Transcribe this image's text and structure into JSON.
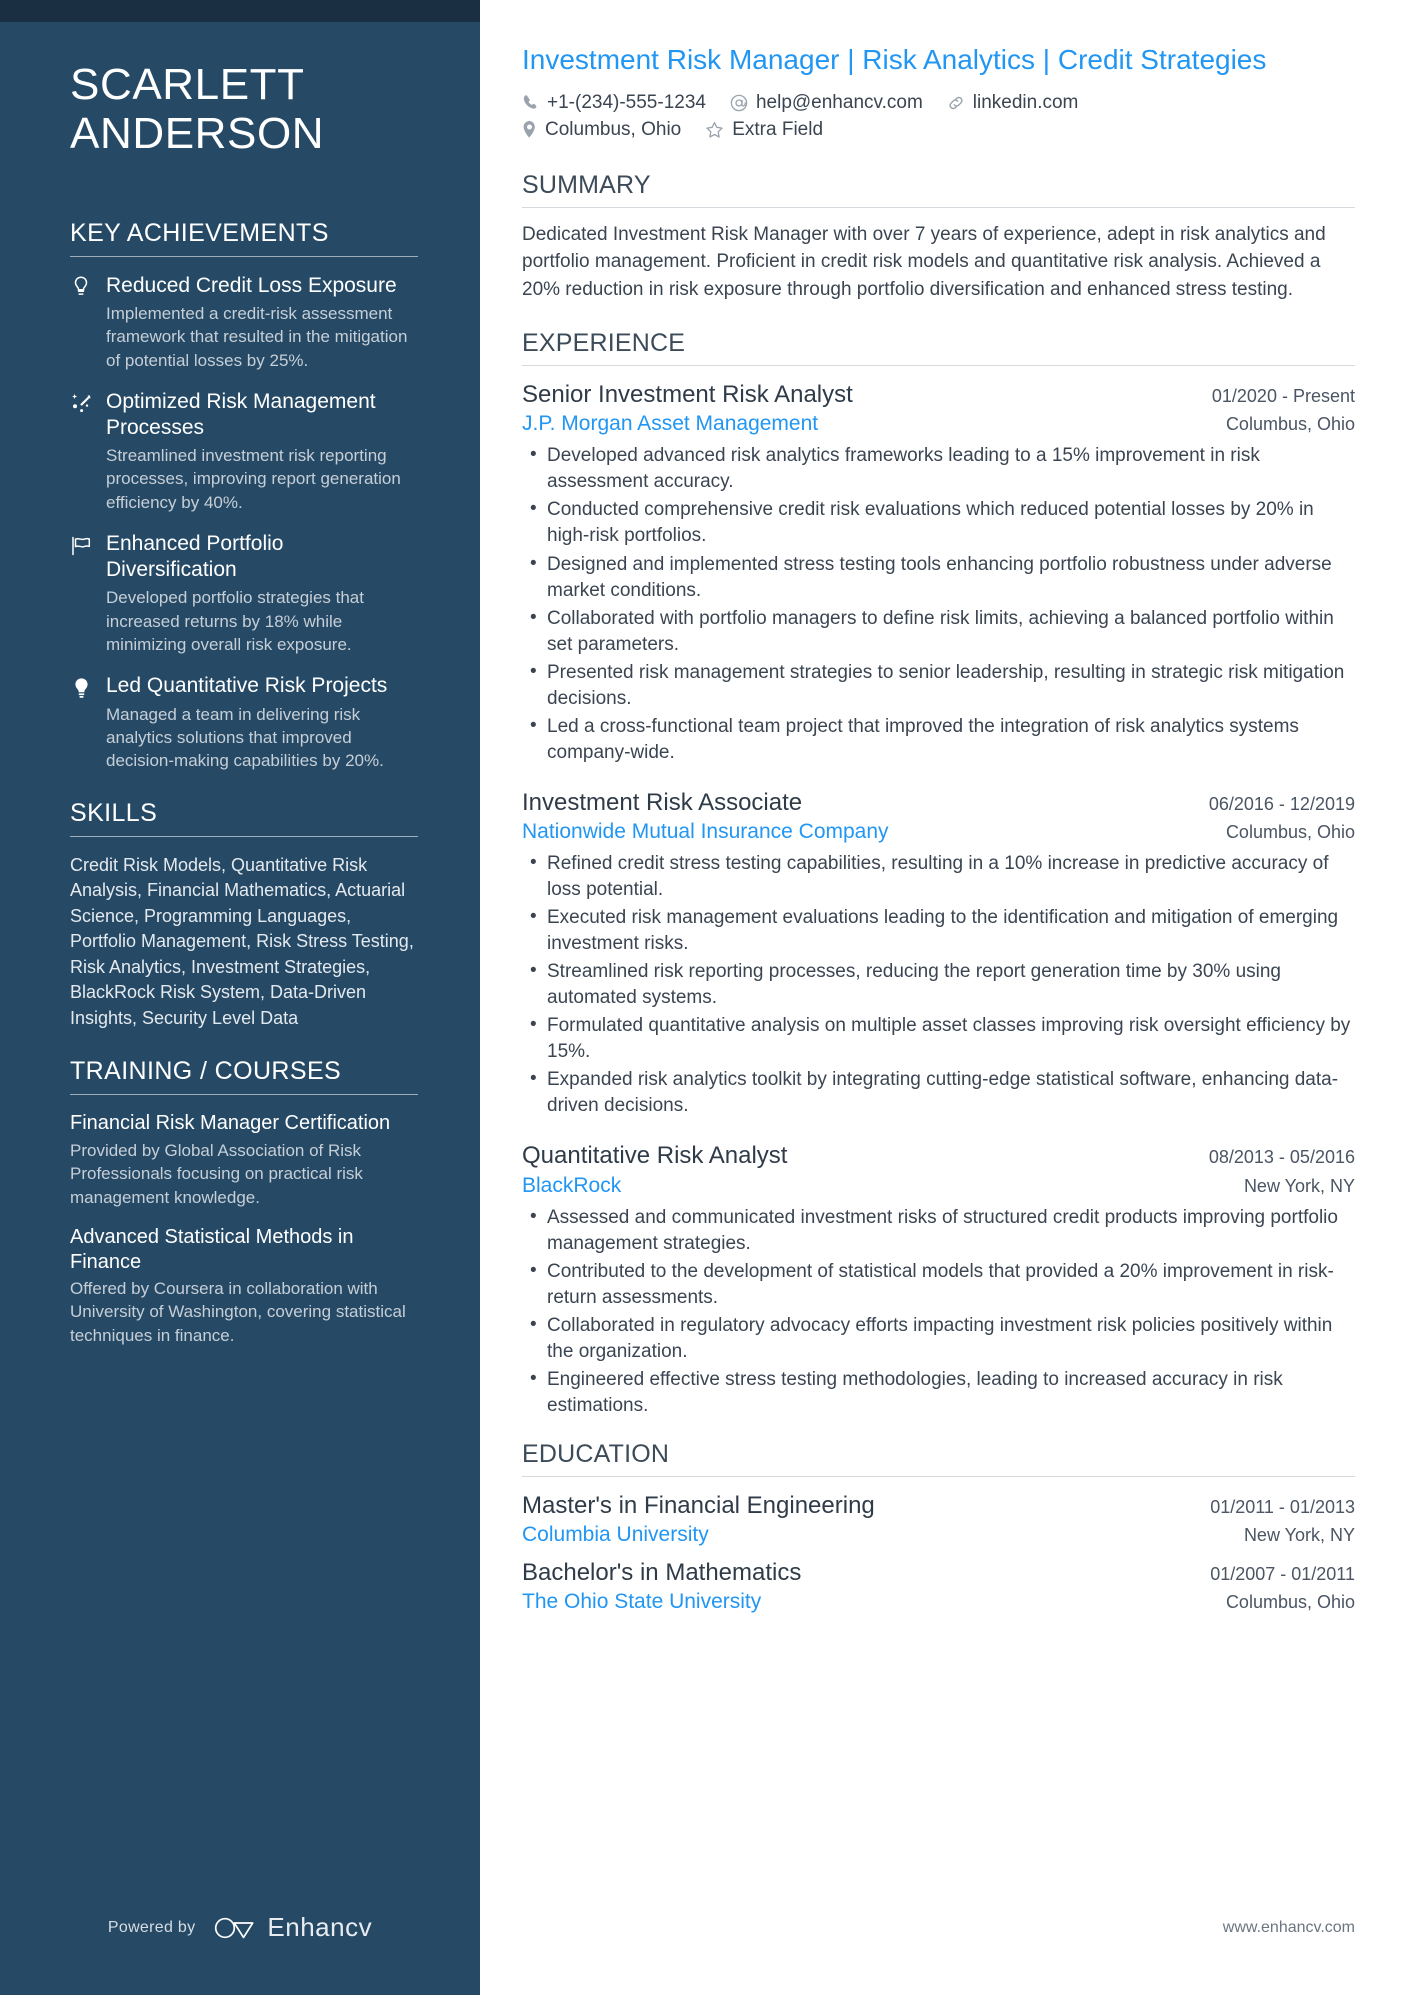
{
  "sidebar": {
    "name": {
      "first": "SCARLETT",
      "last": "ANDERSON"
    },
    "key_achievements": {
      "heading": "KEY ACHIEVEMENTS",
      "items": [
        {
          "icon": "lightbulb-outline-icon",
          "title": "Reduced Credit Loss Exposure",
          "description": "Implemented a credit-risk assessment framework that resulted in the mitigation of potential losses by 25%."
        },
        {
          "icon": "sparkle-arrow-icon",
          "title": "Optimized Risk Management Processes",
          "description": "Streamlined investment risk reporting processes, improving report generation efficiency by 40%."
        },
        {
          "icon": "flag-icon",
          "title": "Enhanced Portfolio Diversification",
          "description": "Developed portfolio strategies that increased returns by 18% while minimizing overall risk exposure."
        },
        {
          "icon": "lightbulb-filled-icon",
          "title": "Led Quantitative Risk Projects",
          "description": "Managed a team in delivering risk analytics solutions that improved decision-making capabilities by 20%."
        }
      ]
    },
    "skills": {
      "heading": "SKILLS",
      "text": "Credit Risk Models, Quantitative Risk Analysis, Financial Mathematics, Actuarial Science, Programming Languages, Portfolio Management, Risk Stress Testing, Risk Analytics, Investment Strategies, BlackRock Risk System, Data-Driven Insights, Security Level Data"
    },
    "training": {
      "heading": "TRAINING / COURSES",
      "items": [
        {
          "title": "Financial Risk Manager Certification",
          "description": "Provided by Global Association of Risk Professionals focusing on practical risk management knowledge."
        },
        {
          "title": "Advanced Statistical Methods in Finance",
          "description": "Offered by Coursera in collaboration with University of Washington, covering statistical techniques in finance."
        }
      ]
    },
    "footer": {
      "powered_by": "Powered by",
      "brand": "Enhancv"
    }
  },
  "main": {
    "headline": "Investment Risk Manager | Risk Analytics | Credit Strategies",
    "contacts": [
      {
        "icon": "phone-icon",
        "text": "+1-(234)-555-1234"
      },
      {
        "icon": "at-email-icon",
        "text": "help@enhancv.com"
      },
      {
        "icon": "link-icon",
        "text": "linkedin.com"
      },
      {
        "icon": "location-pin-icon",
        "text": "Columbus, Ohio"
      },
      {
        "icon": "star-icon",
        "text": "Extra Field"
      }
    ],
    "summary": {
      "heading": "SUMMARY",
      "text": "Dedicated Investment Risk Manager with over 7 years of experience, adept in risk analytics and portfolio management. Proficient in credit risk models and quantitative risk analysis. Achieved a 20% reduction in risk exposure through portfolio diversification and enhanced stress testing."
    },
    "experience": {
      "heading": "EXPERIENCE",
      "jobs": [
        {
          "title": "Senior Investment Risk Analyst",
          "dates": "01/2020 - Present",
          "company": "J.P. Morgan Asset Management",
          "location": "Columbus, Ohio",
          "bullets": [
            "Developed advanced risk analytics frameworks leading to a 15% improvement in risk assessment accuracy.",
            "Conducted comprehensive credit risk evaluations which reduced potential losses by 20% in high-risk portfolios.",
            "Designed and implemented stress testing tools enhancing portfolio robustness under adverse market conditions.",
            "Collaborated with portfolio managers to define risk limits, achieving a balanced portfolio within set parameters.",
            "Presented risk management strategies to senior leadership, resulting in strategic risk mitigation decisions.",
            "Led a cross-functional team project that improved the integration of risk analytics systems company-wide."
          ]
        },
        {
          "title": "Investment Risk Associate",
          "dates": "06/2016 - 12/2019",
          "company": "Nationwide Mutual Insurance Company",
          "location": "Columbus, Ohio",
          "bullets": [
            "Refined credit stress testing capabilities, resulting in a 10% increase in predictive accuracy of loss potential.",
            "Executed risk management evaluations leading to the identification and mitigation of emerging investment risks.",
            "Streamlined risk reporting processes, reducing the report generation time by 30% using automated systems.",
            "Formulated quantitative analysis on multiple asset classes improving risk oversight efficiency by 15%.",
            "Expanded risk analytics toolkit by integrating cutting-edge statistical software, enhancing data-driven decisions."
          ]
        },
        {
          "title": "Quantitative Risk Analyst",
          "dates": "08/2013 - 05/2016",
          "company": "BlackRock",
          "location": "New York, NY",
          "bullets": [
            "Assessed and communicated investment risks of structured credit products improving portfolio management strategies.",
            "Contributed to the development of statistical models that provided a 20% improvement in risk-return assessments.",
            "Collaborated in regulatory advocacy efforts impacting investment risk policies positively within the organization.",
            "Engineered effective stress testing methodologies, leading to increased accuracy in risk estimations."
          ]
        }
      ]
    },
    "education": {
      "heading": "EDUCATION",
      "items": [
        {
          "degree": "Master's in Financial Engineering",
          "dates": "01/2011 - 01/2013",
          "school": "Columbia University",
          "location": "New York, NY"
        },
        {
          "degree": "Bachelor's in Mathematics",
          "dates": "01/2007 - 01/2011",
          "school": "The Ohio State University",
          "location": "Columbus, Ohio"
        }
      ]
    },
    "footer_url": "www.enhancv.com"
  },
  "colors": {
    "sidebar_bg": "#264a66",
    "sidebar_topbar": "#1b2f43",
    "accent_blue": "#2196f3",
    "body_text": "#3b4552"
  }
}
